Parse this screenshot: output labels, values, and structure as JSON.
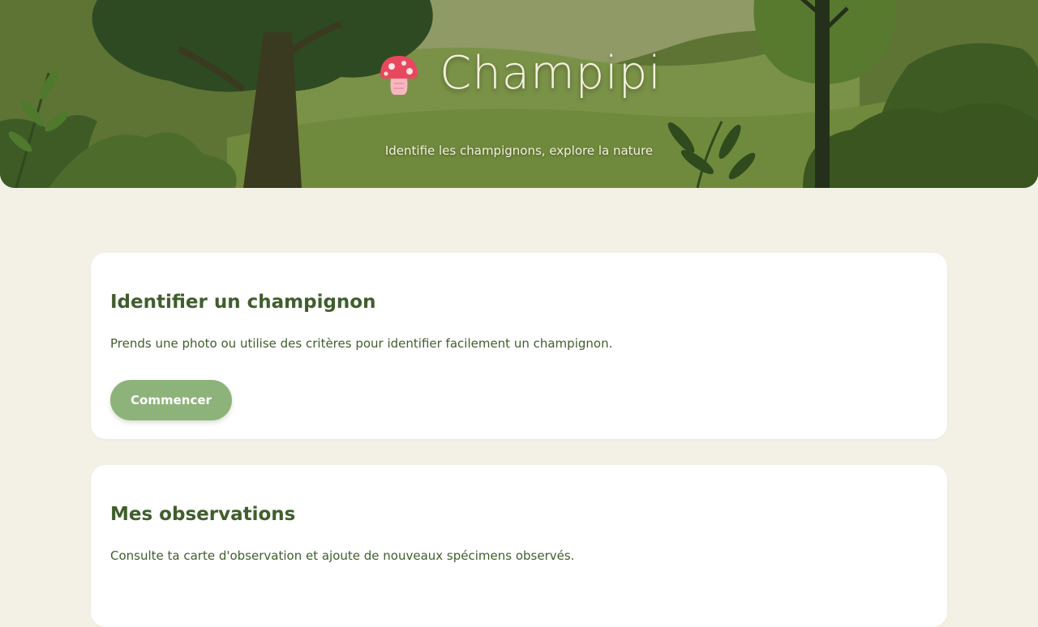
{
  "header": {
    "app_name": "Champipi",
    "logo_icon": "mushroom-icon",
    "tagline": "Identifie les champignons, explore la nature"
  },
  "cards": [
    {
      "title": "Identifier un champignon",
      "description": "Prends une photo ou utilise des critères pour identifier facilement un champignon.",
      "button_label": "Commencer"
    },
    {
      "title": "Mes observations",
      "description": "Consulte ta carte d'observation et ajoute de nouveaux spécimens observés."
    }
  ],
  "colors": {
    "background": "#f3f1e6",
    "primary_text": "#3f5e2c",
    "button": "#8db37a",
    "hero_text": "#f4f0de"
  }
}
